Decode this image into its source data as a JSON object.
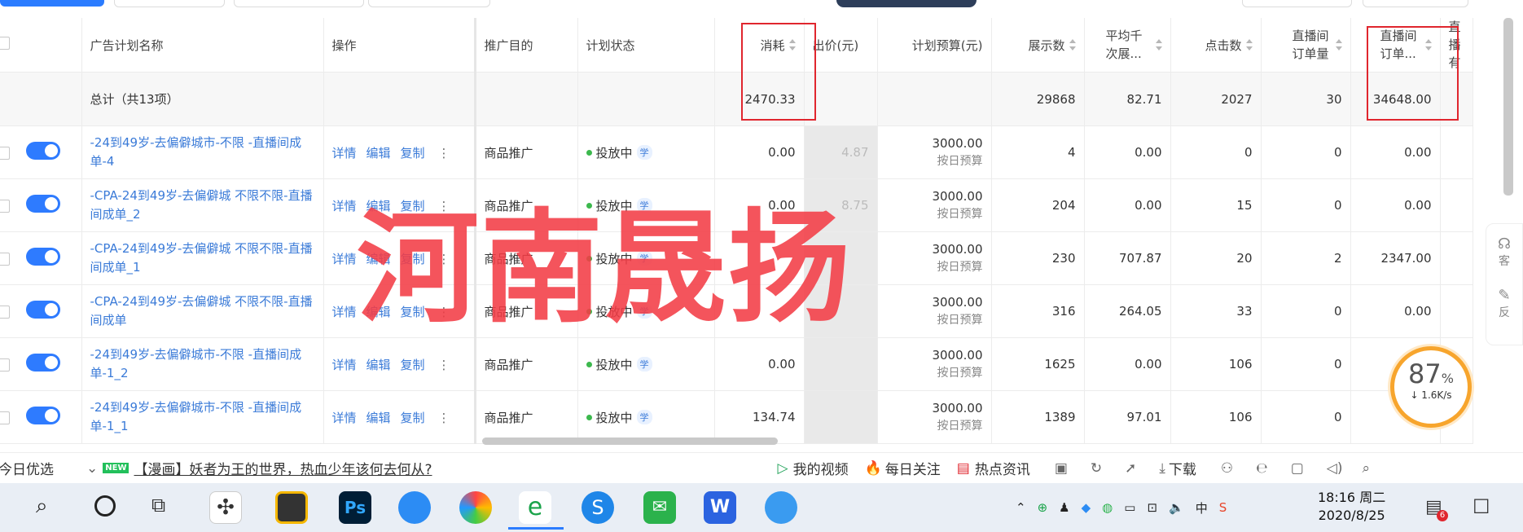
{
  "columns": {
    "plan_name": "广告计划名称",
    "ops": "操作",
    "purpose": "推广目的",
    "status": "计划状态",
    "cost": "消耗",
    "bid": "出价(元)",
    "budget": "计划预算(元)",
    "impressions": "展示数",
    "cpm": "平均千次展...",
    "clicks": "点击数",
    "live_orders": "直播间订单量",
    "live_amount": "直播间订单...",
    "cut": "直播有"
  },
  "totals": {
    "label": "总计（共13项）",
    "cost": "2470.33",
    "impressions": "29868",
    "cpm": "82.71",
    "clicks": "2027",
    "live_orders": "30",
    "live_amount": "34648.00"
  },
  "ops_labels": {
    "detail": "详情",
    "edit": "编辑",
    "copy": "复制"
  },
  "rows": [
    {
      "name": "-24到49岁-去偏僻城市-不限 -直播间成单-4",
      "purpose": "商品推广",
      "status": "投放中",
      "learn": "学",
      "cost": "0.00",
      "bid": "4.87",
      "budget": "3000.00",
      "budget_type": "按日预算",
      "impressions": "4",
      "cpm": "0.00",
      "clicks": "0",
      "live_orders": "0",
      "live_amount": "0.00"
    },
    {
      "name": "-CPA-24到49岁-去偏僻城 不限不限-直播间成单_2",
      "purpose": "商品推广",
      "status": "投放中",
      "learn": "学",
      "cost": "0.00",
      "bid": "8.75",
      "budget": "3000.00",
      "budget_type": "按日预算",
      "impressions": "204",
      "cpm": "0.00",
      "clicks": "15",
      "live_orders": "0",
      "live_amount": "0.00"
    },
    {
      "name": "-CPA-24到49岁-去偏僻城 不限不限-直播间成单_1",
      "purpose": "商品推广",
      "status": "投放中",
      "learn": "学",
      "cost": "",
      "bid": "",
      "budget": "3000.00",
      "budget_type": "按日预算",
      "impressions": "230",
      "cpm": "707.87",
      "clicks": "20",
      "live_orders": "2",
      "live_amount": "2347.00"
    },
    {
      "name": "-CPA-24到49岁-去偏僻城 不限不限-直播间成单",
      "purpose": "商品推广",
      "status": "投放中",
      "learn": "学",
      "cost": "",
      "bid": "",
      "budget": "3000.00",
      "budget_type": "按日预算",
      "impressions": "316",
      "cpm": "264.05",
      "clicks": "33",
      "live_orders": "0",
      "live_amount": "0.00"
    },
    {
      "name": "-24到49岁-去偏僻城市-不限 -直播间成单-1_2",
      "purpose": "商品推广",
      "status": "投放中",
      "learn": "学",
      "cost": "0.00",
      "bid": "",
      "budget": "3000.00",
      "budget_type": "按日预算",
      "impressions": "1625",
      "cpm": "0.00",
      "clicks": "106",
      "live_orders": "0",
      "live_amount": ""
    },
    {
      "name": "-24到49岁-去偏僻城市-不限 -直播间成单-1_1",
      "purpose": "商品推广",
      "status": "投放中",
      "learn": "学",
      "cost": "134.74",
      "bid": "",
      "budget": "3000.00",
      "budget_type": "按日预算",
      "impressions": "1389",
      "cpm": "97.01",
      "clicks": "106",
      "live_orders": "0",
      "live_amount": "0.00"
    }
  ],
  "watermark": "河南晟扬",
  "side_panel": {
    "a": "客",
    "b": "反"
  },
  "gauge": {
    "percent": "87",
    "unit": "%",
    "speed": "↓ 1.6K/s"
  },
  "newsbar": {
    "left": "今日优选",
    "new_badge": "NEW",
    "headline": "【漫画】妖者为王的世界，热血少年该何去何从?",
    "my_video": "我的视频",
    "daily": "每日关注",
    "hot": "热点资讯",
    "download": "下载"
  },
  "taskbar": {
    "time": "18:16 周二",
    "date": "2020/8/25",
    "ime": "中",
    "notif": "6"
  }
}
